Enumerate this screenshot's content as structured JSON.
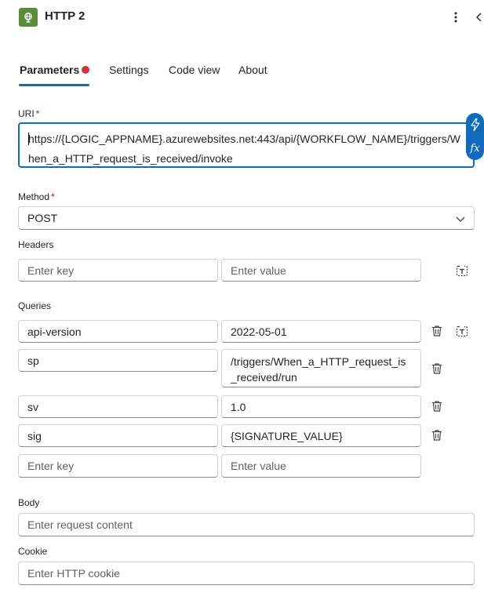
{
  "header": {
    "title": "HTTP 2",
    "icon": "globe-icon",
    "brand_color": "#5b8c3a"
  },
  "tabs": [
    {
      "label": "Parameters",
      "active": true,
      "has_error": true
    },
    {
      "label": "Settings",
      "active": false
    },
    {
      "label": "Code view",
      "active": false
    },
    {
      "label": "About",
      "active": false
    }
  ],
  "uri": {
    "label": "URI",
    "required_mark": "*",
    "value": "https://{LOGIC_APPNAME}.azurewebsites.net:443/api/{WORKFLOW_NAME}/triggers/When_a_HTTP_request_is_received/invoke"
  },
  "method": {
    "label": "Method",
    "required_mark": "*",
    "value": "POST"
  },
  "headers": {
    "label": "Headers",
    "key_placeholder": "Enter key",
    "value_placeholder": "Enter value"
  },
  "queries": {
    "label": "Queries",
    "rows": [
      {
        "key": "api-version",
        "value": "2022-05-01"
      },
      {
        "key": "sp",
        "value": "/triggers/When_a_HTTP_request_is_received/run"
      },
      {
        "key": "sv",
        "value": "1.0"
      },
      {
        "key": "sig",
        "value": "{SIGNATURE_VALUE}"
      }
    ],
    "key_placeholder": "Enter key",
    "value_placeholder": "Enter value"
  },
  "body": {
    "label": "Body",
    "placeholder": "Enter request content"
  },
  "cookie": {
    "label": "Cookie",
    "placeholder": "Enter HTTP cookie"
  },
  "colors": {
    "accent": "#0f6cbd",
    "error": "#d13438",
    "required": "#c50f1f"
  }
}
